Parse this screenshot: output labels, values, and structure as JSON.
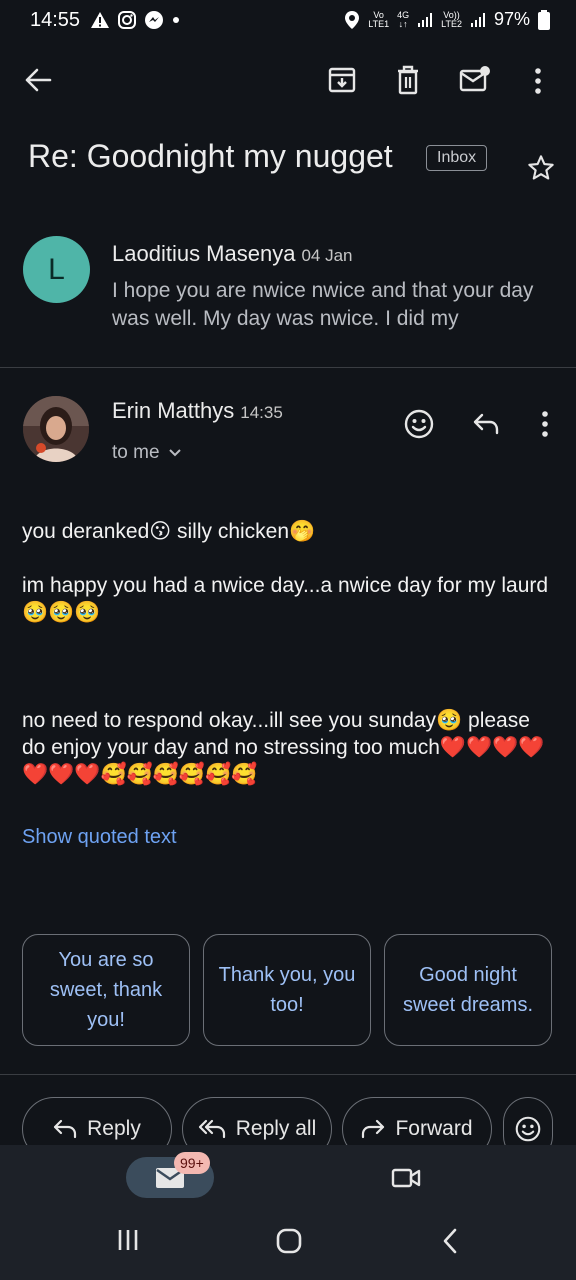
{
  "status_bar": {
    "time": "14:55",
    "net1_top": "Vo",
    "net1_bottom": "LTE1",
    "net2_top": "4G",
    "net2_bottom": "↓↑",
    "net3_top": "Vo))",
    "net3_bottom": "LTE2",
    "battery": "97%"
  },
  "toolbar": {
    "icons": [
      "back-arrow-icon",
      "archive-icon",
      "trash-icon",
      "mark-unread-icon",
      "more-vert-icon"
    ]
  },
  "thread": {
    "subject": "Re: Goodnight my nugget",
    "label": "Inbox"
  },
  "collapsed_message": {
    "avatar_letter": "L",
    "sender": "Laoditius Masenya",
    "date": "04 Jan",
    "snippet": "I hope you are nwice nwice and that your day was well. My day was nwice. I did my"
  },
  "expanded_message": {
    "sender": "Erin Matthys",
    "time": "14:35",
    "recipient_line": "to me",
    "body": [
      "you deranked😗 silly chicken🤭",
      "im happy you had a nwice day...a nwice day for my laurd🥹🥹🥹",
      "no need to respond okay...ill see you sunday🥹 please do enjoy your day and no stressing too much❤️❤️❤️❤️❤️❤️❤️🥰🥰🥰🥰🥰🥰"
    ],
    "show_quoted": "Show quoted text"
  },
  "smart_replies": [
    "You are so sweet, thank you!",
    "Thank you, you too!",
    "Good night sweet dreams."
  ],
  "actions": {
    "reply": "Reply",
    "reply_all": "Reply all",
    "forward": "Forward"
  },
  "bottom_nav": {
    "mail_badge": "99+"
  },
  "colors": {
    "background": "#111419",
    "accent_link": "#6ea2f2",
    "avatar_l": "#4fb5a8",
    "nav_bg": "#1d2128"
  }
}
